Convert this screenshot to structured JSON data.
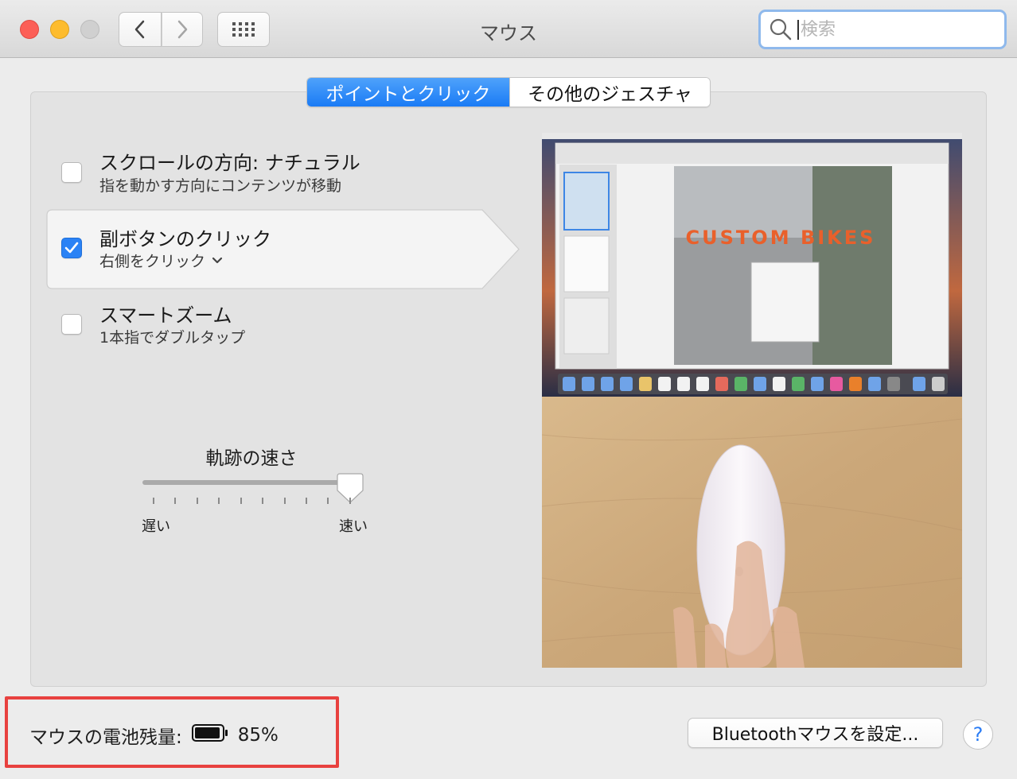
{
  "window": {
    "title": "マウス"
  },
  "toolbar": {
    "search_placeholder": "検索"
  },
  "tabs": [
    {
      "label": "ポイントとクリック",
      "active": true
    },
    {
      "label": "その他のジェスチャ",
      "active": false
    }
  ],
  "options": [
    {
      "title": "スクロールの方向: ナチュラル",
      "subtitle": "指を動かす方向にコンテンツが移動",
      "checked": false
    },
    {
      "title": "副ボタンのクリック",
      "subtitle": "右側をクリック",
      "checked": true
    },
    {
      "title": "スマートズーム",
      "subtitle": "1本指でダブルタップ",
      "checked": false
    }
  ],
  "tracking_speed": {
    "title": "軌跡の速さ",
    "min_label": "遅い",
    "max_label": "速い",
    "value_fraction": 1.0
  },
  "preview": {
    "overlay_text": "CUSTOM BIKES"
  },
  "footer": {
    "battery_label": "マウスの電池残量:",
    "battery_percent": "85%",
    "bluetooth_button": "Bluetoothマウスを設定...",
    "help_button": "?"
  },
  "colors": {
    "accent": "#1a7bf5",
    "highlight": "#e8413f"
  }
}
